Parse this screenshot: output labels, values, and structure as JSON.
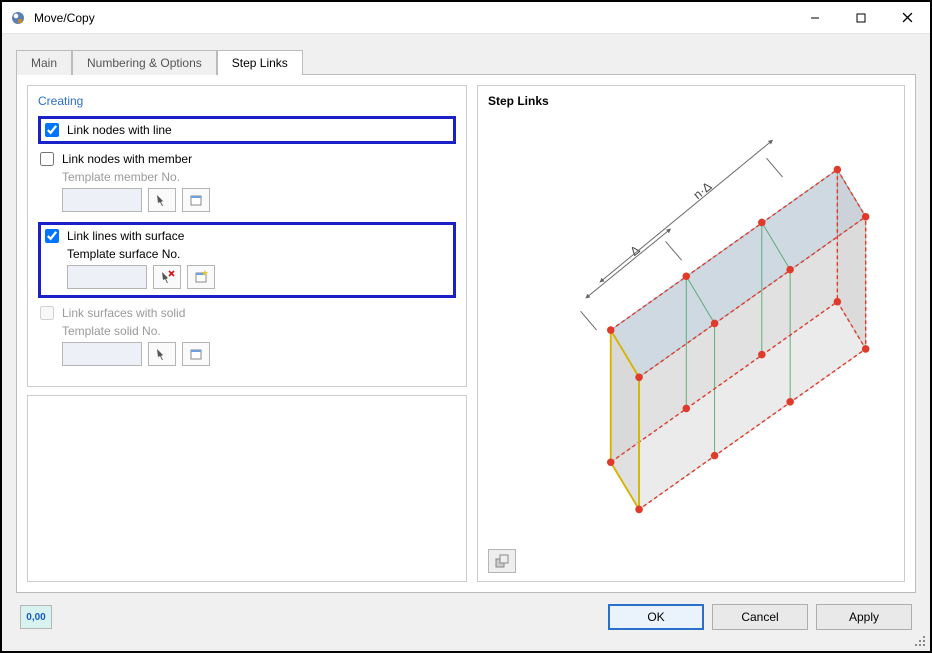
{
  "window": {
    "title": "Move/Copy"
  },
  "tabs": {
    "main": "Main",
    "numbering": "Numbering & Options",
    "step_links": "Step Links"
  },
  "creating": {
    "legend": "Creating",
    "link_nodes_line": {
      "label": "Link nodes with line",
      "checked": true
    },
    "link_nodes_member": {
      "label": "Link nodes with member",
      "checked": false
    },
    "template_member": "Template member No.",
    "link_lines_surface": {
      "label": "Link lines with surface",
      "checked": true
    },
    "template_surface": "Template surface No.",
    "link_surfaces_solid": {
      "label": "Link surfaces with solid",
      "checked": false,
      "disabled": true
    },
    "template_solid": "Template solid No."
  },
  "preview": {
    "legend": "Step Links",
    "dim_labels": {
      "segment": "Δ",
      "total": "n·Δ"
    }
  },
  "buttons": {
    "ok": "OK",
    "cancel": "Cancel",
    "apply": "Apply",
    "decimal": "0,00"
  },
  "icons": {
    "pick": "pick-icon",
    "new": "new-icon",
    "pick_delete": "pick-delete-icon",
    "preview_tool": "preview-tool-icon"
  }
}
